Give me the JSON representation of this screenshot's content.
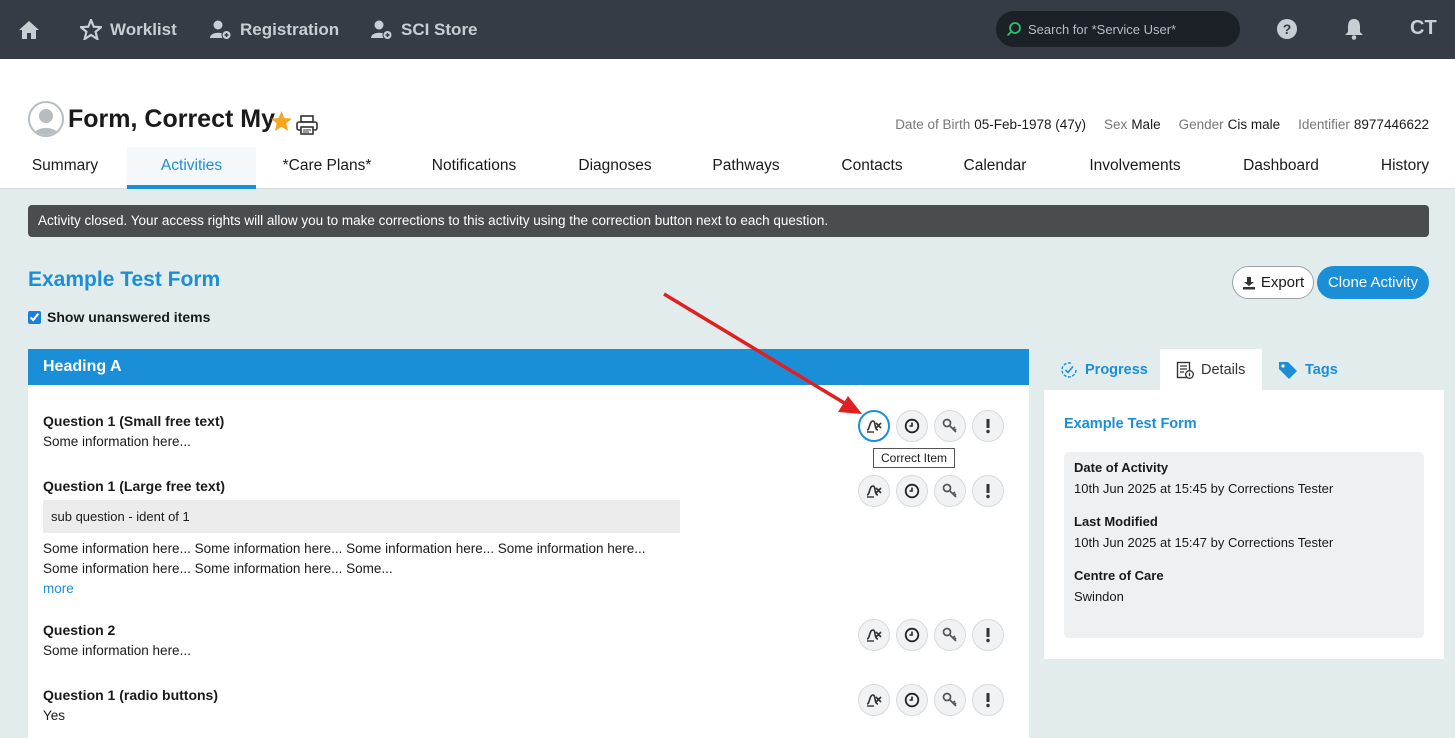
{
  "nav": {
    "home_icon": "home-icon",
    "items": [
      {
        "label": "Worklist",
        "icon": "star-icon"
      },
      {
        "label": "Registration",
        "icon": "user-add-icon"
      },
      {
        "label": "SCI Store",
        "icon": "user-add-icon"
      }
    ],
    "search_placeholder": "Search for *Service User*",
    "initials": "CT"
  },
  "patient": {
    "name": "Form, Correct My",
    "dob_label": "Date of Birth",
    "dob_value": "05-Feb-1978 (47y)",
    "sex_label": "Sex",
    "sex_value": "Male",
    "gender_label": "Gender",
    "gender_value": "Cis male",
    "identifier_label": "Identifier",
    "identifier_value": "8977446622"
  },
  "tabs": [
    "Summary",
    "Activities",
    "*Care Plans*",
    "Notifications",
    "Diagnoses",
    "Pathways",
    "Contacts",
    "Calendar",
    "Involvements",
    "Dashboard",
    "History"
  ],
  "active_tab": "Activities",
  "banner": "Activity closed. Your access rights will allow you to make corrections to this activity using the correction button next to each question.",
  "form": {
    "title": "Example Test Form",
    "export_label": "Export",
    "clone_label": "Clone Activity",
    "show_unanswered": "Show unanswered items",
    "heading": "Heading A",
    "questions": [
      {
        "title": "Question 1 (Small free text)",
        "value": "Some information here..."
      },
      {
        "title": "Question 1 (Large free text)",
        "sub": "sub question - ident of 1",
        "value": "Some information here... Some information here... Some information here... Some information here... Some information here... Some information here... Some...",
        "more": "more"
      },
      {
        "title": "Question 2",
        "value": "Some information here..."
      },
      {
        "title": "Question 1 (radio buttons)",
        "value": "Yes"
      }
    ],
    "tooltip": "Correct Item"
  },
  "side": {
    "tabs": [
      {
        "label": "Progress",
        "icon": "check-circle-icon"
      },
      {
        "label": "Details",
        "icon": "details-icon"
      },
      {
        "label": "Tags",
        "icon": "tag-icon"
      }
    ],
    "title": "Example Test Form",
    "doa_label": "Date of Activity",
    "doa_value": "10th Jun 2025 at 15:45 by Corrections Tester",
    "lm_label": "Last Modified",
    "lm_value": "10th Jun 2025 at 15:47 by Corrections Tester",
    "coc_label": "Centre of Care",
    "coc_value": "Swindon"
  },
  "colors": {
    "accent": "#1a8fd8",
    "topbar": "#353c45",
    "banner": "#4a4d50",
    "arrow": "#e02020",
    "star": "#f5a623"
  }
}
